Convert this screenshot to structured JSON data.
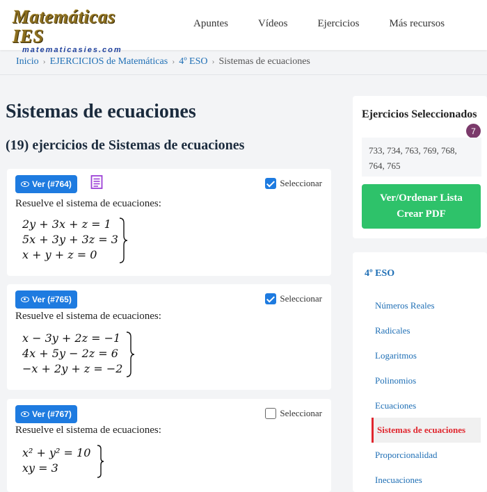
{
  "logo": {
    "title": "Matemáticas IES",
    "subtitle": "matematicasies.com"
  },
  "nav": {
    "items": [
      "Apuntes",
      "Vídeos",
      "Ejercicios",
      "Más recursos"
    ]
  },
  "breadcrumb": [
    "Inicio",
    "EJERCICIOS de Matemáticas",
    "4º ESO",
    "Sistemas de ecuaciones"
  ],
  "page": {
    "title": "Sistemas de ecuaciones",
    "subtitle": "(19) ejercicios de Sistemas de ecuaciones"
  },
  "exercises": [
    {
      "button": "Ver (#764)",
      "select_label": "Seleccionar",
      "selected": true,
      "has_doc_icon": true,
      "prompt": "Resuelve el sistema de ecuaciones:",
      "equations": [
        "2y + 3x + z = 1",
        "5x + 3y + 3z = 3",
        "x + y + z = 0"
      ]
    },
    {
      "button": "Ver (#765)",
      "select_label": "Seleccionar",
      "selected": true,
      "has_doc_icon": false,
      "prompt": "Resuelve el sistema de ecuaciones:",
      "equations": [
        "x − 3y + 2z = −1",
        "4x + 5y − 2z = 6",
        "−x + 2y + z = −2"
      ]
    },
    {
      "button": "Ver (#767)",
      "select_label": "Seleccionar",
      "selected": false,
      "has_doc_icon": false,
      "prompt": "Resuelve el sistema de ecuaciones:",
      "equations": [
        "x² + y² = 10",
        "xy = 3"
      ]
    }
  ],
  "selected_panel": {
    "title": "Ejercicios Seleccionados",
    "count": "7",
    "list": "733, 734, 763, 769, 768, 764, 765",
    "button_line1": "Ver/Ordenar Lista",
    "button_line2": "Crear PDF",
    "button_color": "#2ec26a"
  },
  "topic_menu": {
    "heading": "4º ESO",
    "items": [
      "Números Reales",
      "Radicales",
      "Logaritmos",
      "Polinomios",
      "Ecuaciones",
      "Sistemas de ecuaciones",
      "Proporcionalidad",
      "Inecuaciones"
    ],
    "active": "Sistemas de ecuaciones"
  },
  "colors": {
    "link": "#1f6fb5",
    "primary_button": "#1e7be0",
    "active_item": "#e0262e",
    "badge": "#7b3a6b"
  }
}
